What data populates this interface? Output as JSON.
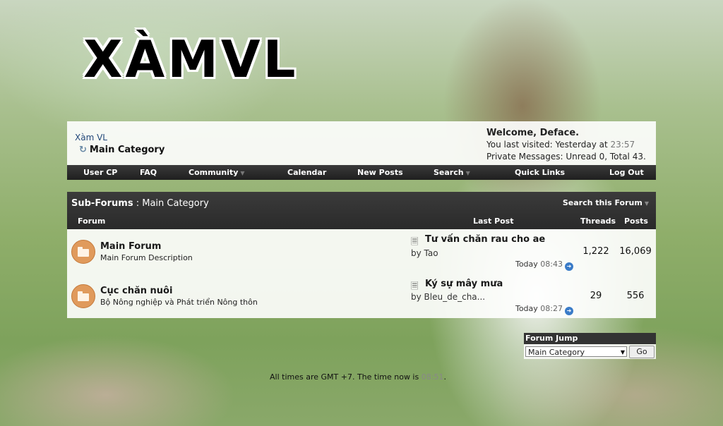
{
  "logo": "XÀMVL",
  "breadcrumb": {
    "root": "Xàm VL",
    "current": "Main Category"
  },
  "welcome": {
    "greeting": "Welcome, Deface.",
    "last_visited_label": "You last visited: Yesterday at",
    "last_visited_time": "23:57",
    "pm_label": "Private Messages:",
    "pm_value": "Unread 0, Total 43."
  },
  "nav": [
    "User CP",
    "FAQ",
    "Community",
    "Calendar",
    "New Posts",
    "Search",
    "Quick Links",
    "Log Out"
  ],
  "subforums": {
    "title": "Sub-Forums",
    "separator": ":",
    "category": "Main Category",
    "search_label": "Search this Forum",
    "columns": {
      "forum": "Forum",
      "last_post": "Last Post",
      "threads": "Threads",
      "posts": "Posts"
    }
  },
  "forums": [
    {
      "name": "Main Forum",
      "description": "Main Forum Description",
      "last_post_title": "Tư vấn chăn rau cho ae",
      "by_label": "by",
      "last_post_user": "Tao",
      "date": "Today",
      "time": "08:43",
      "threads": "1,222",
      "posts": "16,069"
    },
    {
      "name": "Cục chăn nuôi",
      "description": "Bộ Nông nghiệp và Phát triển Nông thôn",
      "last_post_title": "Ký sự mây mưa",
      "by_label": "by",
      "last_post_user": "Bleu_de_cha...",
      "date": "Today",
      "time": "08:27",
      "threads": "29",
      "posts": "556"
    }
  ],
  "forum_jump": {
    "title": "Forum Jump",
    "selected": "Main Category",
    "go": "Go"
  },
  "footer": {
    "prefix": "All times are GMT +7. The time now is",
    "time": "08:51",
    "suffix": "."
  }
}
